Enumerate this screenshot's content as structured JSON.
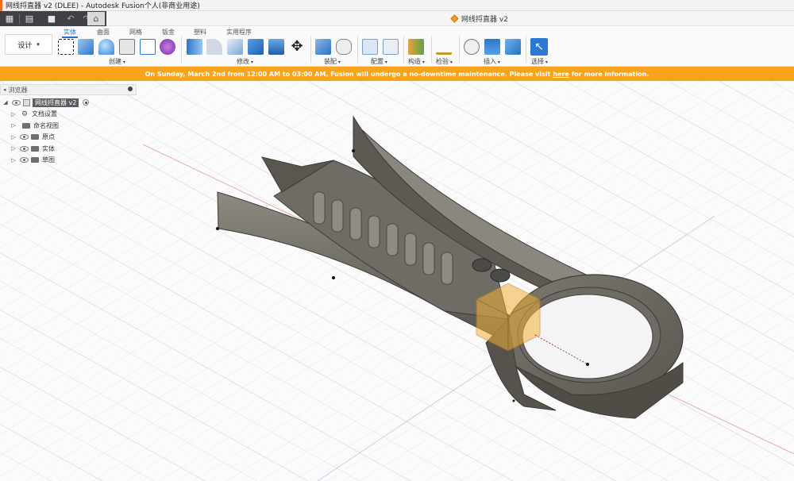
{
  "window": {
    "title": "网线捋直器 v2 (DLEE) - Autodesk Fusion个人(非商业用途)"
  },
  "document_tab": {
    "label": "网线捋直器 v2"
  },
  "quick_access": {
    "grid_icon": "grid-icon",
    "file_icon": "file-icon",
    "save_icon": "save-icon",
    "undo_icon": "undo-icon",
    "redo_icon": "redo-icon",
    "home_icon": "home-icon"
  },
  "workspace": {
    "label": "设计"
  },
  "tabs": [
    {
      "label": "实体",
      "active": true
    },
    {
      "label": "曲面",
      "active": false
    },
    {
      "label": "网格",
      "active": false
    },
    {
      "label": "钣金",
      "active": false
    },
    {
      "label": "塑料",
      "active": false
    },
    {
      "label": "实用程序",
      "active": false
    }
  ],
  "groups": {
    "create": "创建",
    "modify": "修改",
    "assemble": "装配",
    "configure": "配置",
    "construct": "构造",
    "inspect": "检验",
    "insert": "插入",
    "select": "选择"
  },
  "notice": {
    "text_before": "On Sunday, March 2nd from 12:00 AM to 03:00 AM, Fusion will undergo a no-downtime maintenance. Please visit",
    "link": "here",
    "text_after": "for more information.",
    "color": "#f7a41b"
  },
  "browser": {
    "title": "浏览器",
    "root": "网线捋直器 v2",
    "items": [
      {
        "label": "文档设置",
        "icon": "gear-icon"
      },
      {
        "label": "命名视图",
        "icon": "folder-icon"
      },
      {
        "label": "原点",
        "icon": "folder-icon"
      },
      {
        "label": "实体",
        "icon": "folder-icon"
      },
      {
        "label": "草图",
        "icon": "folder-icon"
      }
    ]
  },
  "colors": {
    "accent": "#1f6fd1",
    "brand": "#f26b21",
    "model": "#6a6760"
  }
}
